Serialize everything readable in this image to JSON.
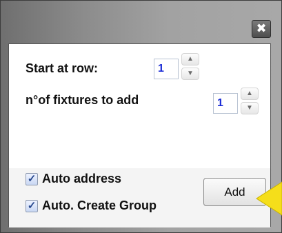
{
  "window": {
    "close_icon": "close-icon",
    "close_glyph": "✖"
  },
  "dialog": {
    "start_row": {
      "label": "Start at row:",
      "value": "1"
    },
    "fixtures": {
      "label": "n°of fixtures to add",
      "value": "1"
    },
    "auto_address": {
      "label": "Auto address",
      "checked": true
    },
    "auto_group": {
      "label": "Auto. Create Group",
      "checked": true
    },
    "add_button": "Add"
  },
  "colors": {
    "highlight_arrow": "#f5de1a",
    "spin_value": "#1a2bd6"
  }
}
